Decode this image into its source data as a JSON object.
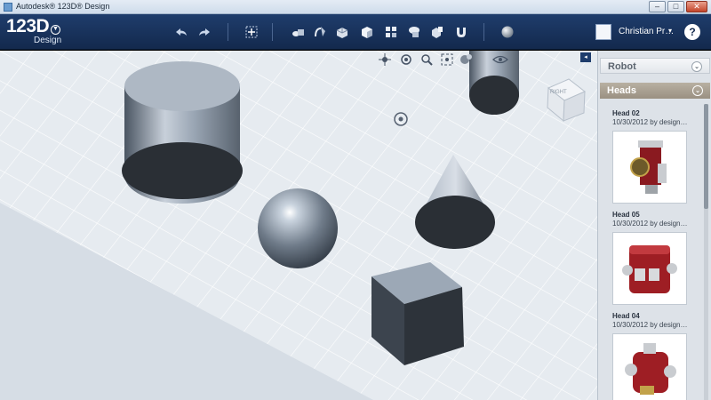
{
  "window": {
    "title": "Autodesk® 123D® Design",
    "controls": {
      "minimize": "–",
      "maximize": "□",
      "close": "✕"
    }
  },
  "toolbar": {
    "logo_main": "123D",
    "logo_sub": "Design",
    "logo_menu": "▼",
    "icons": [
      "undo-icon",
      "redo-icon",
      "transform-icon",
      "primitives-icon",
      "sketch-icon",
      "construct-icon",
      "modify-icon",
      "pattern-icon",
      "grouping-icon",
      "combine-icon",
      "snap-icon",
      "material-icon"
    ],
    "user_name": "Christian Pr…",
    "user_caret": "▾",
    "help": "?"
  },
  "viewport": {
    "view_cube_label": "RIGHT",
    "nav_tools": [
      "pan-icon",
      "orbit-icon",
      "zoom-icon",
      "fit-icon",
      "view-options-icon",
      "visibility-icon"
    ],
    "expand": "◂"
  },
  "panel": {
    "sections": [
      {
        "label": "Robot",
        "chevron": "⌄"
      },
      {
        "label": "Heads",
        "chevron": "⌄"
      }
    ],
    "items": [
      {
        "name": "Head 02",
        "meta": "10/30/2012 by design…"
      },
      {
        "name": "Head 05",
        "meta": "10/30/2012 by design…"
      },
      {
        "name": "Head 04",
        "meta": "10/30/2012 by design…"
      }
    ]
  },
  "colors": {
    "toolbar_bg": "#1f3d6c",
    "viewport_bg": "#dce3ea",
    "heads_header": "#a89e90",
    "head_red": "#9e1e24"
  }
}
